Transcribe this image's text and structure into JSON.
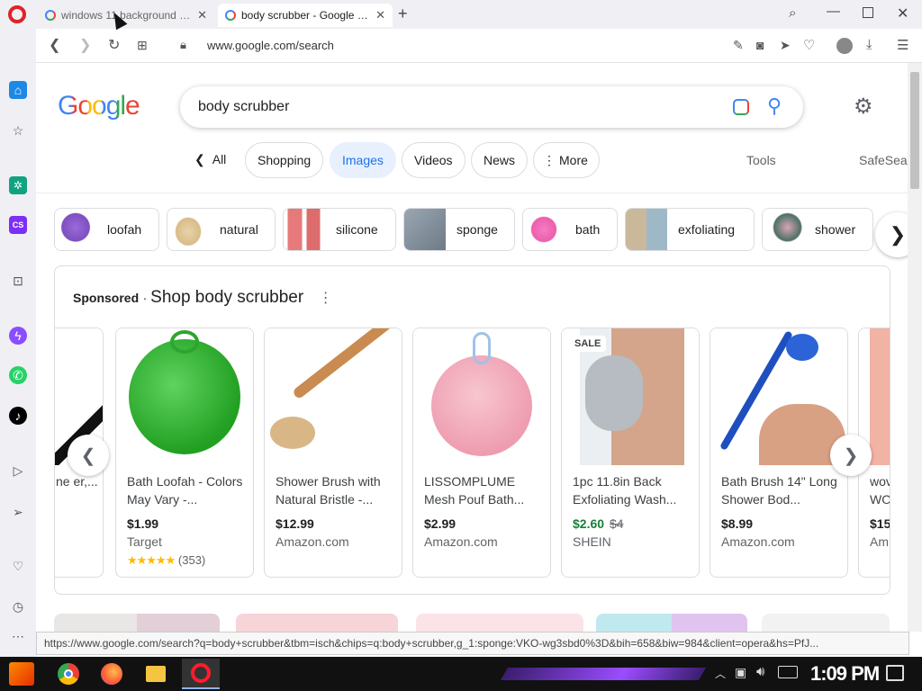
{
  "tabs": [
    {
      "title": "windows 11 background b..."
    },
    {
      "title": "body scrubber - Google Sea..."
    }
  ],
  "address": {
    "url": "www.google.com/search"
  },
  "google": {
    "logo": "Google",
    "query": "body scrubber",
    "filters": [
      "All",
      "Shopping",
      "Images",
      "Videos",
      "News",
      "More"
    ],
    "tools": "Tools",
    "safesearch": "SafeSear"
  },
  "related": [
    {
      "label": "loofah",
      "color": "#8e5ac9"
    },
    {
      "label": "natural",
      "color": "#e6cf9f"
    },
    {
      "label": "silicone",
      "color": "#e07575"
    },
    {
      "label": "sponge",
      "color": "#7a8895"
    },
    {
      "label": "bath",
      "color": "#f06cb8"
    },
    {
      "label": "exfoliating",
      "color": "#a9b6a8"
    },
    {
      "label": "shower",
      "color": "#4c6f65"
    }
  ],
  "shop": {
    "sponsored": "Sponsored",
    "title": "Shop body scrubber",
    "partial_left": {
      "name": "ne er,..."
    },
    "products": [
      {
        "name": "Bath Loofah - Colors May Vary -...",
        "price": "$1.99",
        "store": "Target",
        "stars": "★★★★★",
        "reviews": "(353)",
        "color": "#3fb73f"
      },
      {
        "name": "Shower Brush with Natural Bristle -...",
        "price": "$12.99",
        "store": "Amazon.com",
        "color": "#c98b4f"
      },
      {
        "name": "LISSOMPLUME Mesh Pouf Bath...",
        "price": "$2.99",
        "store": "Amazon.com",
        "color": "#f2aebd"
      },
      {
        "name": "1pc 11.8in Back Exfoliating Wash...",
        "price": "$2.60",
        "oldprice": "$4",
        "store": "SHEIN",
        "sale": "SALE",
        "color": "#d4a58a"
      },
      {
        "name": "Bath Brush 14\" Long Shower Bod...",
        "price": "$8.99",
        "store": "Amazon.com",
        "color": "#1f4fbf"
      }
    ],
    "partial_right": {
      "name": "wov WO",
      "price": "$15",
      "store": "Am"
    }
  },
  "statusbar": "https://www.google.com/search?q=body+scrubber&tbm=isch&chips=q:body+scrubber,g_1:sponge:VKO-wg3sbd0%3D&bih=658&biw=984&client=opera&hs=PfJ...",
  "taskbar": {
    "clock": "1:09 PM"
  }
}
